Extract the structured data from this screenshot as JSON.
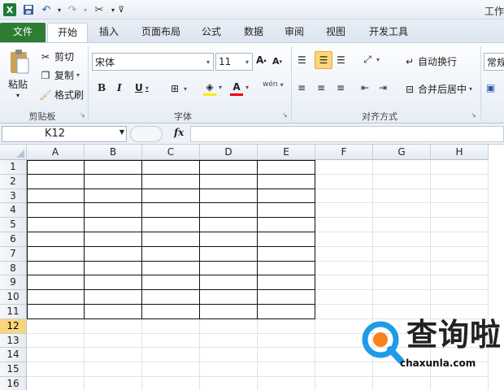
{
  "window": {
    "title": "工作"
  },
  "qat": {
    "logo": "X",
    "icons": [
      "save-icon",
      "undo-icon",
      "redo-icon",
      "tools-icon",
      "customize-icon"
    ]
  },
  "tabs": [
    "文件",
    "开始",
    "插入",
    "页面布局",
    "公式",
    "数据",
    "审阅",
    "视图",
    "开发工具"
  ],
  "ribbon": {
    "clipboard": {
      "paste": "粘贴",
      "cut": "剪切",
      "copy": "复制",
      "format_painter": "格式刷",
      "label": "剪贴板"
    },
    "font": {
      "name": "宋体",
      "size": "11",
      "bold": "B",
      "italic": "I",
      "underline": "U",
      "phonetic": "wén",
      "label": "字体"
    },
    "align": {
      "wrap": "自动换行",
      "merge": "合并后居中",
      "label": "对齐方式"
    },
    "number": {
      "format": "常规"
    }
  },
  "formula": {
    "name_box": "K12",
    "fx": "fx",
    "value": ""
  },
  "sheet": {
    "columns": [
      "A",
      "B",
      "C",
      "D",
      "E",
      "F",
      "G",
      "H"
    ],
    "rows": [
      "1",
      "2",
      "3",
      "4",
      "5",
      "6",
      "7",
      "8",
      "9",
      "10",
      "11",
      "12",
      "13",
      "14",
      "15",
      "16"
    ],
    "selected_row": "12"
  },
  "watermark": {
    "text": "查询啦",
    "url": "chaxunla.com"
  },
  "colors": {
    "file_tab": "#2e7d32",
    "row_selected": "#f9d67a",
    "logo_blue": "#1e9be9",
    "logo_orange": "#f5821f"
  }
}
